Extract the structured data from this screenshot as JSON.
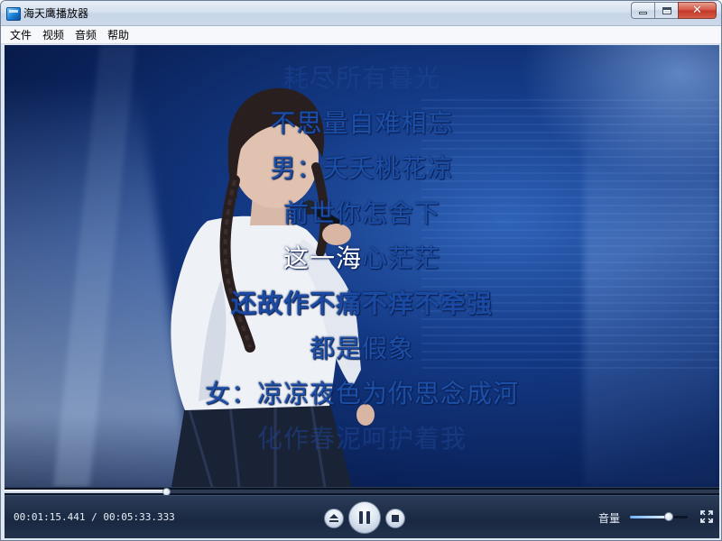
{
  "window": {
    "title": "海天鹰播放器",
    "icon": "video-player-icon",
    "controls": {
      "minimize_icon": "minimize-icon",
      "maximize_icon": "maximize-icon",
      "close_label": "✕"
    }
  },
  "menu": {
    "items": [
      "文件",
      "视频",
      "音频",
      "帮助"
    ]
  },
  "lyrics": {
    "lines": [
      "耗尽所有暮光",
      "不思量自难相忘",
      "男：夭夭桃花凉",
      "前世你怎舍下",
      "心茫茫",
      "还故作不痛不痒不牵强",
      "都是假象",
      "女：凉凉夜色为你思念成河",
      "化作春泥呵护着我"
    ],
    "current_line_sung": "这一海",
    "colors": {
      "unsung": "#1c4fa8",
      "sung": "#ffffff"
    }
  },
  "playback": {
    "time_display": "00:01:15.441 / 00:05:33.333",
    "elapsed": "00:01:15.441",
    "duration": "00:05:33.333",
    "progress_fraction": 0.2264,
    "state": "playing"
  },
  "controls": {
    "eject_icon": "eject-icon",
    "pause_icon": "pause-icon",
    "stop_icon": "stop-icon",
    "fullscreen_icon": "fullscreen-icon"
  },
  "volume": {
    "label": "音量",
    "level_fraction": 0.67
  },
  "colors": {
    "control_bar": "#1f2e48",
    "video_background": "#143a86"
  }
}
